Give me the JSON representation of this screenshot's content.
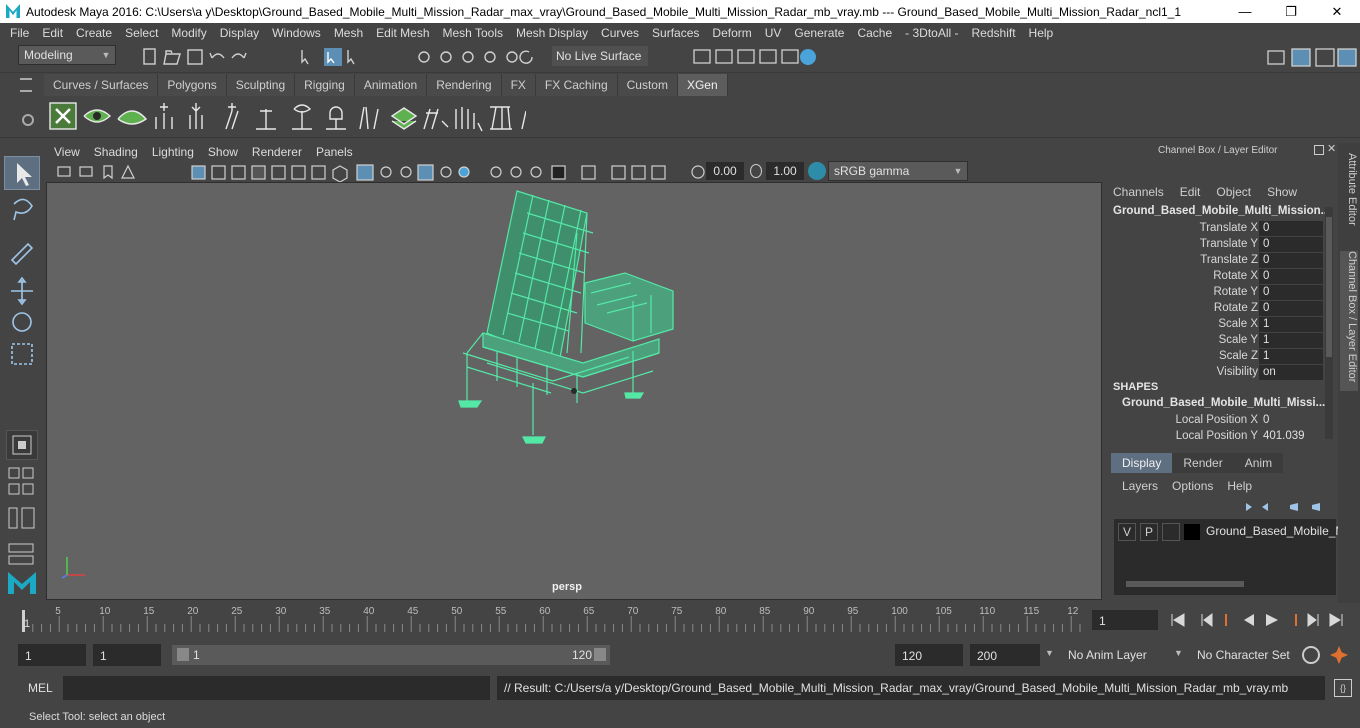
{
  "window": {
    "title": "Autodesk Maya 2016: C:\\Users\\a y\\Desktop\\Ground_Based_Mobile_Multi_Mission_Radar_max_vray\\Ground_Based_Mobile_Multi_Mission_Radar_mb_vray.mb  ---  Ground_Based_Mobile_Multi_Mission_Radar_ncl1_1",
    "minimize": "—",
    "maximize": "❐",
    "close": "✕"
  },
  "menubar": [
    "File",
    "Edit",
    "Create",
    "Select",
    "Modify",
    "Display",
    "Windows",
    "Mesh",
    "Edit Mesh",
    "Mesh Tools",
    "Mesh Display",
    "Curves",
    "Surfaces",
    "Deform",
    "UV",
    "Generate",
    "Cache",
    "- 3DtoAll -",
    "Redshift",
    "Help"
  ],
  "status": {
    "workspace": "Modeling",
    "live_surface": "No Live Surface"
  },
  "shelf_tabs": [
    {
      "label": "Curves / Surfaces",
      "active": false
    },
    {
      "label": "Polygons",
      "active": false
    },
    {
      "label": "Sculpting",
      "active": false
    },
    {
      "label": "Rigging",
      "active": false
    },
    {
      "label": "Animation",
      "active": false
    },
    {
      "label": "Rendering",
      "active": false
    },
    {
      "label": "FX",
      "active": false
    },
    {
      "label": "FX Caching",
      "active": false
    },
    {
      "label": "Custom",
      "active": false
    },
    {
      "label": "XGen",
      "active": true
    }
  ],
  "viewport": {
    "menus": [
      "View",
      "Shading",
      "Lighting",
      "Show",
      "Renderer",
      "Panels"
    ],
    "exposure": "0.00",
    "gamma": "1.00",
    "color_space": "sRGB gamma",
    "camera": "persp"
  },
  "channel_box": {
    "header": "Channel Box / Layer Editor",
    "menus": [
      "Channels",
      "Edit",
      "Object",
      "Show"
    ],
    "object_name": "Ground_Based_Mobile_Multi_Mission...",
    "attributes": [
      {
        "label": "Translate X",
        "value": "0"
      },
      {
        "label": "Translate Y",
        "value": "0"
      },
      {
        "label": "Translate Z",
        "value": "0"
      },
      {
        "label": "Rotate X",
        "value": "0"
      },
      {
        "label": "Rotate Y",
        "value": "0"
      },
      {
        "label": "Rotate Z",
        "value": "0"
      },
      {
        "label": "Scale X",
        "value": "1"
      },
      {
        "label": "Scale Y",
        "value": "1"
      },
      {
        "label": "Scale Z",
        "value": "1"
      },
      {
        "label": "Visibility",
        "value": "on"
      }
    ],
    "shapes_header": "SHAPES",
    "shape_name": "Ground_Based_Mobile_Multi_Missi...",
    "shape_attributes": [
      {
        "label": "Local Position X",
        "value": "0"
      },
      {
        "label": "Local Position Y",
        "value": "401.039"
      }
    ]
  },
  "layer_editor": {
    "tabs": [
      {
        "label": "Display",
        "active": true
      },
      {
        "label": "Render",
        "active": false
      },
      {
        "label": "Anim",
        "active": false
      }
    ],
    "menus": [
      "Layers",
      "Options",
      "Help"
    ],
    "layer": {
      "v": "V",
      "p": "P",
      "name": "Ground_Based_Mobile_M"
    }
  },
  "side_tabs": [
    "Attribute Editor",
    "Channel Box / Layer Editor"
  ],
  "timeline": {
    "ticks": [
      "5",
      "10",
      "15",
      "20",
      "25",
      "30",
      "35",
      "40",
      "45",
      "50",
      "55",
      "60",
      "65",
      "70",
      "75",
      "80",
      "85",
      "90",
      "95",
      "100",
      "105",
      "110",
      "115",
      "12"
    ],
    "start_marker": "1",
    "current_frame": "1"
  },
  "range": {
    "start": "1",
    "playback_start": "1",
    "slider_start": "1",
    "slider_end": "120",
    "playback_end": "120",
    "end": "200",
    "anim_layer": "No Anim Layer",
    "character_set": "No Character Set"
  },
  "mel": {
    "label": "MEL",
    "result": "// Result: C:/Users/a y/Desktop/Ground_Based_Mobile_Multi_Mission_Radar_max_vray/Ground_Based_Mobile_Multi_Mission_Radar_mb_vray.mb"
  },
  "help_line": "Select Tool: select an object"
}
